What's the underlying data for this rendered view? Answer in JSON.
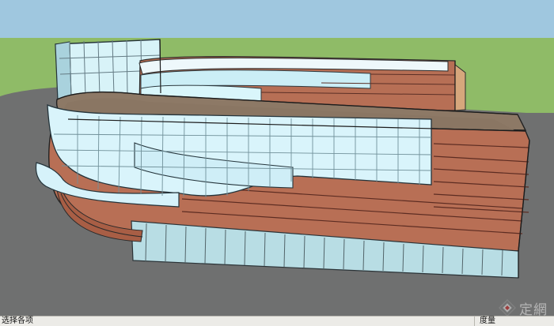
{
  "status": {
    "hint": "选择各项",
    "measure_label": "度量"
  },
  "watermark": {
    "text": "定網"
  },
  "colors": {
    "sky": "#9cc4de",
    "ground_green": "#8fbb67",
    "ground_gray": "#6f7070",
    "brick": "#b86f55",
    "glass": "#d5f0f7",
    "roof": "#8b7764"
  }
}
